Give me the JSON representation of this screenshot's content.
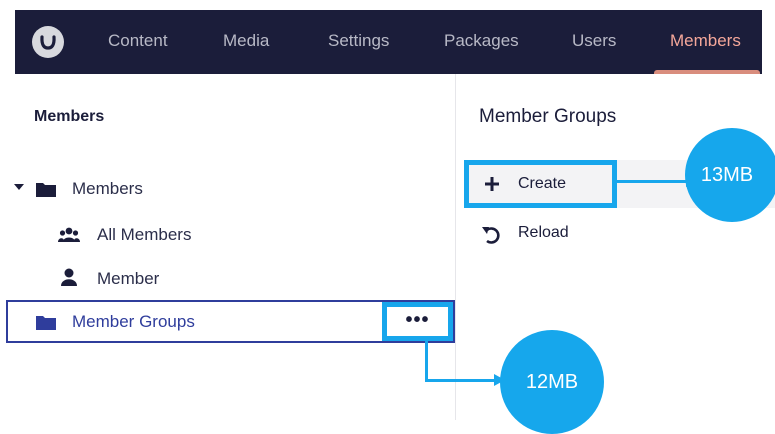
{
  "nav": {
    "items": [
      "Content",
      "Media",
      "Settings",
      "Packages",
      "Users",
      "Members"
    ],
    "active": "Members"
  },
  "tree": {
    "heading": "Members",
    "items": [
      {
        "label": "Members",
        "icon": "folder-icon"
      },
      {
        "label": "All Members",
        "icon": "users-icon"
      },
      {
        "label": "Member",
        "icon": "user-icon"
      },
      {
        "label": "Member Groups",
        "icon": "folder-icon"
      }
    ],
    "options_label": "•••"
  },
  "actions": {
    "title": "Member Groups",
    "items": [
      {
        "label": "Create",
        "icon": "plus-icon"
      },
      {
        "label": "Reload",
        "icon": "reload-icon"
      }
    ]
  },
  "callouts": {
    "create": "13MB",
    "options": "12MB"
  },
  "colors": {
    "nav_bg": "#1b1d3a",
    "nav_active": "#f4a79a",
    "highlight": "#17a6ec",
    "selection_border": "#2f3d9c"
  }
}
